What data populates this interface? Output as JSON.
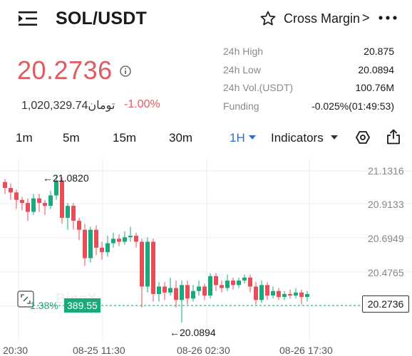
{
  "header": {
    "pair": "SOL/USDT",
    "margin_mode": "Cross Margin",
    "chevron": ">"
  },
  "price": {
    "last": "20.2736",
    "fiat": "1,020,329.74تومان",
    "change_pct": "-1.00%"
  },
  "stats": [
    {
      "label": "24h High",
      "value": "20.875"
    },
    {
      "label": "24h Low",
      "value": "20.0894"
    },
    {
      "label": "24h Vol.(USDT)",
      "value": "100.76M"
    },
    {
      "label": "Funding",
      "value": "-0.025%(01:49:53)"
    }
  ],
  "timeframes": {
    "items": [
      "1m",
      "5m",
      "15m",
      "30m"
    ],
    "active": "1H",
    "indicators": "Indicators"
  },
  "chart": {
    "y_ticks": [
      "21.1316",
      "20.9133",
      "20.6949",
      "20.4765"
    ],
    "x_ticks": [
      "20:30",
      "08-25 11:30",
      "08-26 02:30",
      "08-26 17:30"
    ],
    "high_marker": "←21.0820",
    "low_marker": "←20.0894",
    "current_price": "20.2736",
    "position_pct": "1.38%",
    "position_value": "389.55",
    "watermark": "BingX"
  },
  "colors": {
    "up": "#19a97a",
    "down": "#e84e58",
    "accent": "#2b6fd6"
  },
  "chart_data": {
    "type": "candlestick",
    "ylim": [
      19.98,
      21.2
    ],
    "candles": [
      [
        21.04,
        21.0,
        21.06,
        20.96
      ],
      [
        21.0,
        20.97,
        21.03,
        20.92
      ],
      [
        20.97,
        20.92,
        20.99,
        20.86
      ],
      [
        20.92,
        20.9,
        20.94,
        20.85
      ],
      [
        20.9,
        20.84,
        20.93,
        20.78
      ],
      [
        20.84,
        20.93,
        20.96,
        20.82
      ],
      [
        20.93,
        20.9,
        20.96,
        20.84
      ],
      [
        20.9,
        20.88,
        20.92,
        20.82
      ],
      [
        20.88,
        20.95,
        20.98,
        20.86
      ],
      [
        20.95,
        21.05,
        21.08,
        20.92
      ],
      [
        21.05,
        20.8,
        21.07,
        20.76
      ],
      [
        20.8,
        20.88,
        20.9,
        20.72
      ],
      [
        20.88,
        20.78,
        20.9,
        20.72
      ],
      [
        20.78,
        20.72,
        20.8,
        20.65
      ],
      [
        20.72,
        20.53,
        20.76,
        20.48
      ],
      [
        20.53,
        20.72,
        20.74,
        20.5
      ],
      [
        20.72,
        20.6,
        20.75,
        20.55
      ],
      [
        20.6,
        20.57,
        20.64,
        20.52
      ],
      [
        20.57,
        20.63,
        20.68,
        20.54
      ],
      [
        20.63,
        20.66,
        20.7,
        20.6
      ],
      [
        20.66,
        20.64,
        20.69,
        20.61
      ],
      [
        20.64,
        20.67,
        20.71,
        20.62
      ],
      [
        20.67,
        20.68,
        20.74,
        20.64
      ],
      [
        20.68,
        20.64,
        20.7,
        20.6
      ],
      [
        20.64,
        20.34,
        20.66,
        20.2
      ],
      [
        20.34,
        20.64,
        20.67,
        20.3
      ],
      [
        20.64,
        20.29,
        20.66,
        20.24
      ],
      [
        20.29,
        20.34,
        20.37,
        20.24
      ],
      [
        20.34,
        20.3,
        20.37,
        20.25
      ],
      [
        20.3,
        20.33,
        20.4,
        20.28
      ],
      [
        20.33,
        20.25,
        20.38,
        20.2
      ],
      [
        20.25,
        20.35,
        20.38,
        20.1
      ],
      [
        20.35,
        20.26,
        20.38,
        20.22
      ],
      [
        20.26,
        20.31,
        20.35,
        20.24
      ],
      [
        20.31,
        20.34,
        20.38,
        20.28
      ],
      [
        20.34,
        20.28,
        20.36,
        20.25
      ],
      [
        20.28,
        20.41,
        20.43,
        20.26
      ],
      [
        20.41,
        20.35,
        20.43,
        20.31
      ],
      [
        20.35,
        20.33,
        20.38,
        20.3
      ],
      [
        20.33,
        20.38,
        20.42,
        20.31
      ],
      [
        20.38,
        20.35,
        20.4,
        20.32
      ],
      [
        20.35,
        20.38,
        20.4,
        20.33
      ],
      [
        20.38,
        20.4,
        20.42,
        20.36
      ],
      [
        20.4,
        20.34,
        20.42,
        20.3
      ],
      [
        20.34,
        20.25,
        20.37,
        20.22
      ],
      [
        20.25,
        20.35,
        20.38,
        20.23
      ],
      [
        20.35,
        20.28,
        20.37,
        20.25
      ],
      [
        20.28,
        20.31,
        20.34,
        20.26
      ],
      [
        20.31,
        20.27,
        20.33,
        20.25
      ],
      [
        20.27,
        20.29,
        20.31,
        20.25
      ],
      [
        20.29,
        20.28,
        20.32,
        20.26
      ],
      [
        20.28,
        20.3,
        20.33,
        20.26
      ],
      [
        20.3,
        20.27,
        20.32,
        20.22
      ],
      [
        20.27,
        20.29,
        20.31,
        20.24
      ]
    ]
  }
}
